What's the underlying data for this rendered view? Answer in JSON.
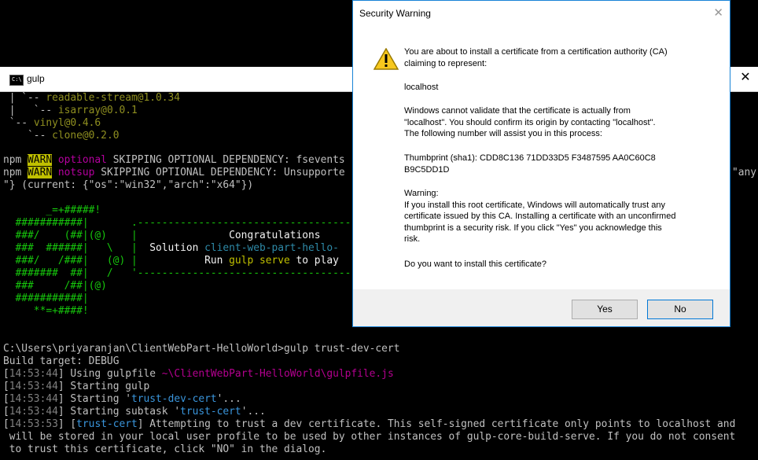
{
  "console": {
    "title": "gulp",
    "close_glyph": "✕",
    "icon_text": "C:\\",
    "lines": {
      "l1a": " | `-- ",
      "l1b": "readable-stream@1.0.34",
      "l2a": " |   `-- ",
      "l2b": "isarray@0.0.1",
      "l3a": " `-- ",
      "l3b": "vinyl@0.4.6",
      "l4a": "    `-- ",
      "l4b": "clone@0.2.0",
      "l5a": "npm ",
      "l5b": "WARN",
      "l5c": " ",
      "l5d": "optional",
      "l5e": " SKIPPING OPTIONAL DEPENDENCY: fsevents",
      "l6a": "npm ",
      "l6b": "WARN",
      "l6c": " ",
      "l6d": "notsup",
      "l6e": " SKIPPING OPTIONAL DEPENDENCY: Unsupporte",
      "l6f": "\"any",
      "l7": "\"} (current: {\"os\":\"win32\",\"arch\":\"x64\"})",
      "a1": "       _=+#####!",
      "a2": "  ###########|       .-----------------------------------",
      "a3a": "  ###/    (##|(@)    |               ",
      "a3b": "Congratulations",
      "a4a": "  ###  ######|   \\   |  ",
      "a4b": "Solution ",
      "a4c": "client-web-part-hello-",
      "a5a": "  ###/   /###|   (@) |           ",
      "a5b": "Run ",
      "a5c": "gulp serve",
      "a5d": " to play",
      "a6": "  #######  ##|   /   '-----------------------------------",
      "a7": "  ###     /##|(@)",
      "a8": "  ###########|",
      "a9": "     **=+####!",
      "p1": "C:\\Users\\priyaranjan\\ClientWebPart-HelloWorld>gulp trust-dev-cert",
      "p2": "Build target: DEBUG",
      "p3a": "[",
      "p3t": "14:53:44",
      "p3b": "] Using gulpfile ",
      "p3c": "~\\ClientWebPart-HelloWorld\\gulpfile.js",
      "p4a": "[",
      "p4t": "14:53:44",
      "p4b": "] Starting gulp",
      "p5a": "[",
      "p5t": "14:53:44",
      "p5b": "] Starting '",
      "p5c": "trust-dev-cert",
      "p5d": "'...",
      "p6a": "[",
      "p6t": "14:53:44",
      "p6b": "] Starting subtask '",
      "p6c": "trust-cert",
      "p6d": "'...",
      "p7a": "[",
      "p7t": "14:53:53",
      "p7b": "] [",
      "p7c": "trust-cert",
      "p7d": "] Attempting to trust a dev certificate. This self-signed certificate only points to localhost and",
      "p8": " will be stored in your local user profile to be used by other instances of gulp-core-build-serve. If you do not consent",
      "p9": " to trust this certificate, click \"NO\" in the dialog."
    }
  },
  "dialog": {
    "title": "Security Warning",
    "close_glyph": "✕",
    "icon": "warning-triangle-icon",
    "text1": "You are about to install a certificate from a certification authority (CA)\nclaiming to represent:",
    "text2": "localhost",
    "text3": "Windows cannot validate that the certificate is actually from\n\"localhost\". You should confirm its origin by contacting \"localhost\".\nThe following number will assist you in this process:",
    "text4": "Thumbprint (sha1): CDD8C136 71DD33D5 F3487595 AA0C60C8\nB9C5DD1D",
    "text5": "Warning:\nIf you install this root certificate, Windows will automatically trust any\ncertificate issued by this CA. Installing a certificate with an unconfirmed\nthumbprint is a security risk. If you click \"Yes\" you acknowledge this\nrisk.",
    "text6": "Do you want to install this certificate?",
    "yes_label": "Yes",
    "no_label": "No"
  }
}
